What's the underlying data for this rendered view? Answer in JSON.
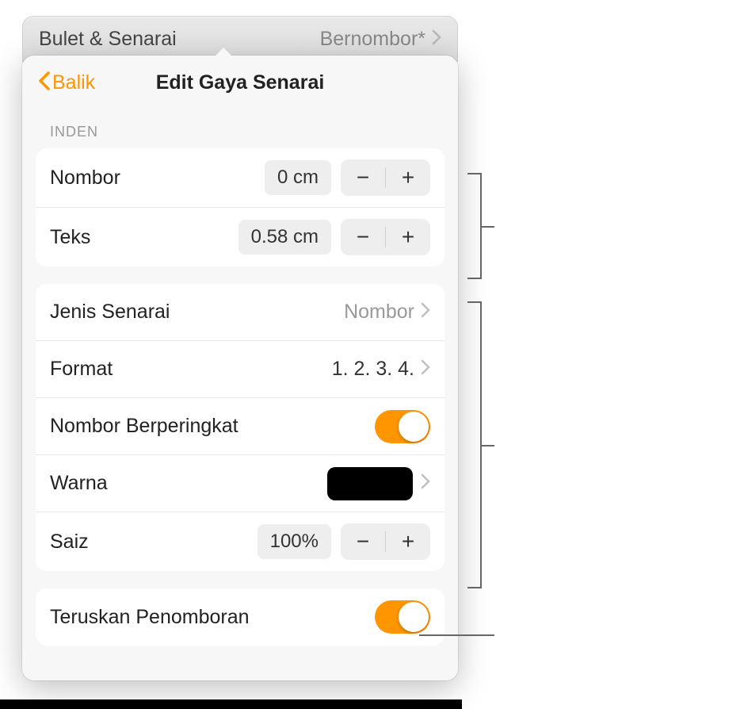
{
  "header": {
    "title": "Bulet & Senarai",
    "value": "Bernombor*"
  },
  "nav": {
    "back_label": "Balik",
    "title": "Edit Gaya Senarai"
  },
  "sections": {
    "indent_header": "INDEN"
  },
  "indent": {
    "number_label": "Nombor",
    "number_value": "0 cm",
    "text_label": "Teks",
    "text_value": "0.58 cm"
  },
  "list_settings": {
    "type_label": "Jenis Senarai",
    "type_value": "Nombor",
    "format_label": "Format",
    "format_value": "1. 2. 3. 4.",
    "tiered_label": "Nombor Berperingkat",
    "color_label": "Warna",
    "color_value": "#000000",
    "size_label": "Saiz",
    "size_value": "100%"
  },
  "continue": {
    "label": "Teruskan Penomboran"
  },
  "glyphs": {
    "minus": "−",
    "plus": "+"
  }
}
